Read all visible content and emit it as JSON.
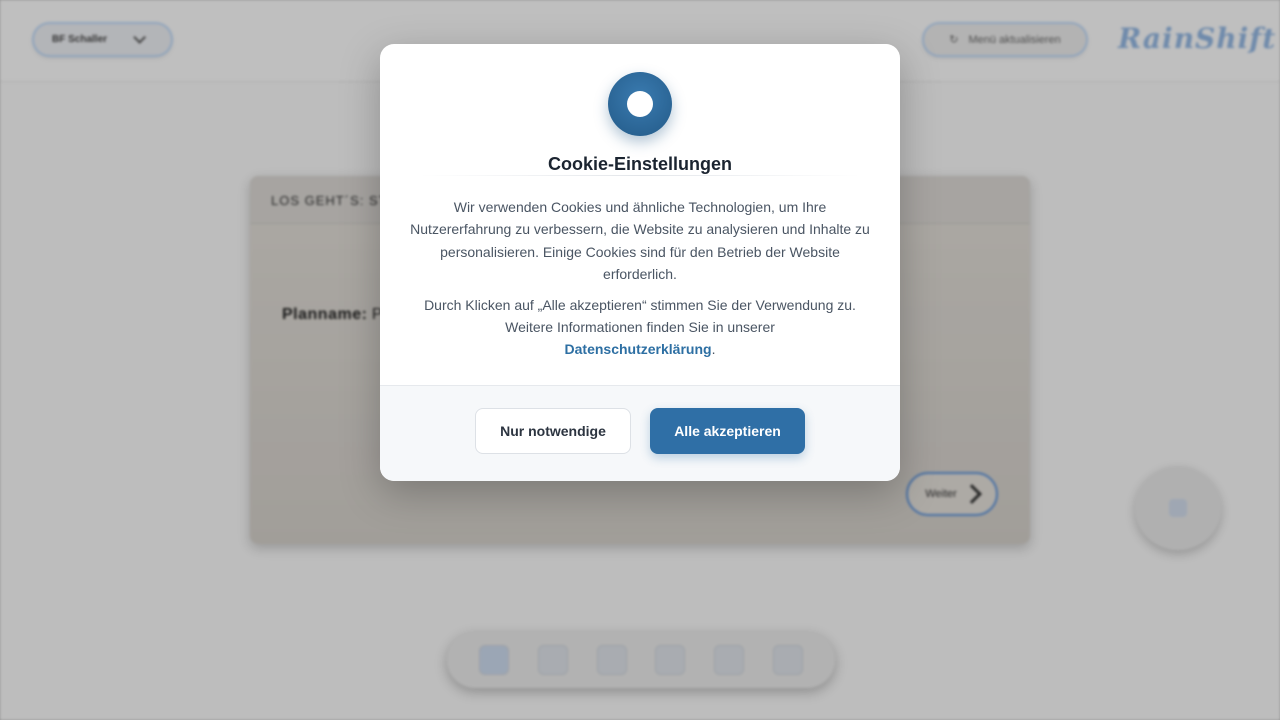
{
  "background": {
    "user_select": {
      "label": "BF Schaller",
      "icon": "chevron-down-icon"
    },
    "reload_button": {
      "label": "Menü aktualisieren",
      "icon": "refresh-icon"
    },
    "logo": "RainShift",
    "card": {
      "header": "LOS GEHT´S: STA",
      "plan_label": "Planname:",
      "plan_value": "Pl",
      "next_label": "Weiter"
    }
  },
  "cookie_modal": {
    "icon": "cookie-icon",
    "title": "Cookie-Einstellungen",
    "paragraph1": "Wir verwenden Cookies und ähnliche Technologien, um Ihre Nutzererfahrung zu verbessern, die Website zu analysieren und Inhalte zu personalisieren. Einige Cookies sind für den Betrieb der Website erforderlich.",
    "paragraph2_text": "Durch Klicken auf „Alle akzeptieren“ stimmen Sie der Verwendung zu. Weitere Informationen finden Sie in unserer",
    "privacy_link": "Datenschutzerklärung",
    "paragraph2_end": ".",
    "buttons": {
      "necessary": "Nur notwendige",
      "accept_all": "Alle akzeptieren"
    }
  },
  "colors": {
    "accent": "#2f6fa6",
    "link": "#2d6fa3",
    "logo": "#8fb2dc"
  }
}
